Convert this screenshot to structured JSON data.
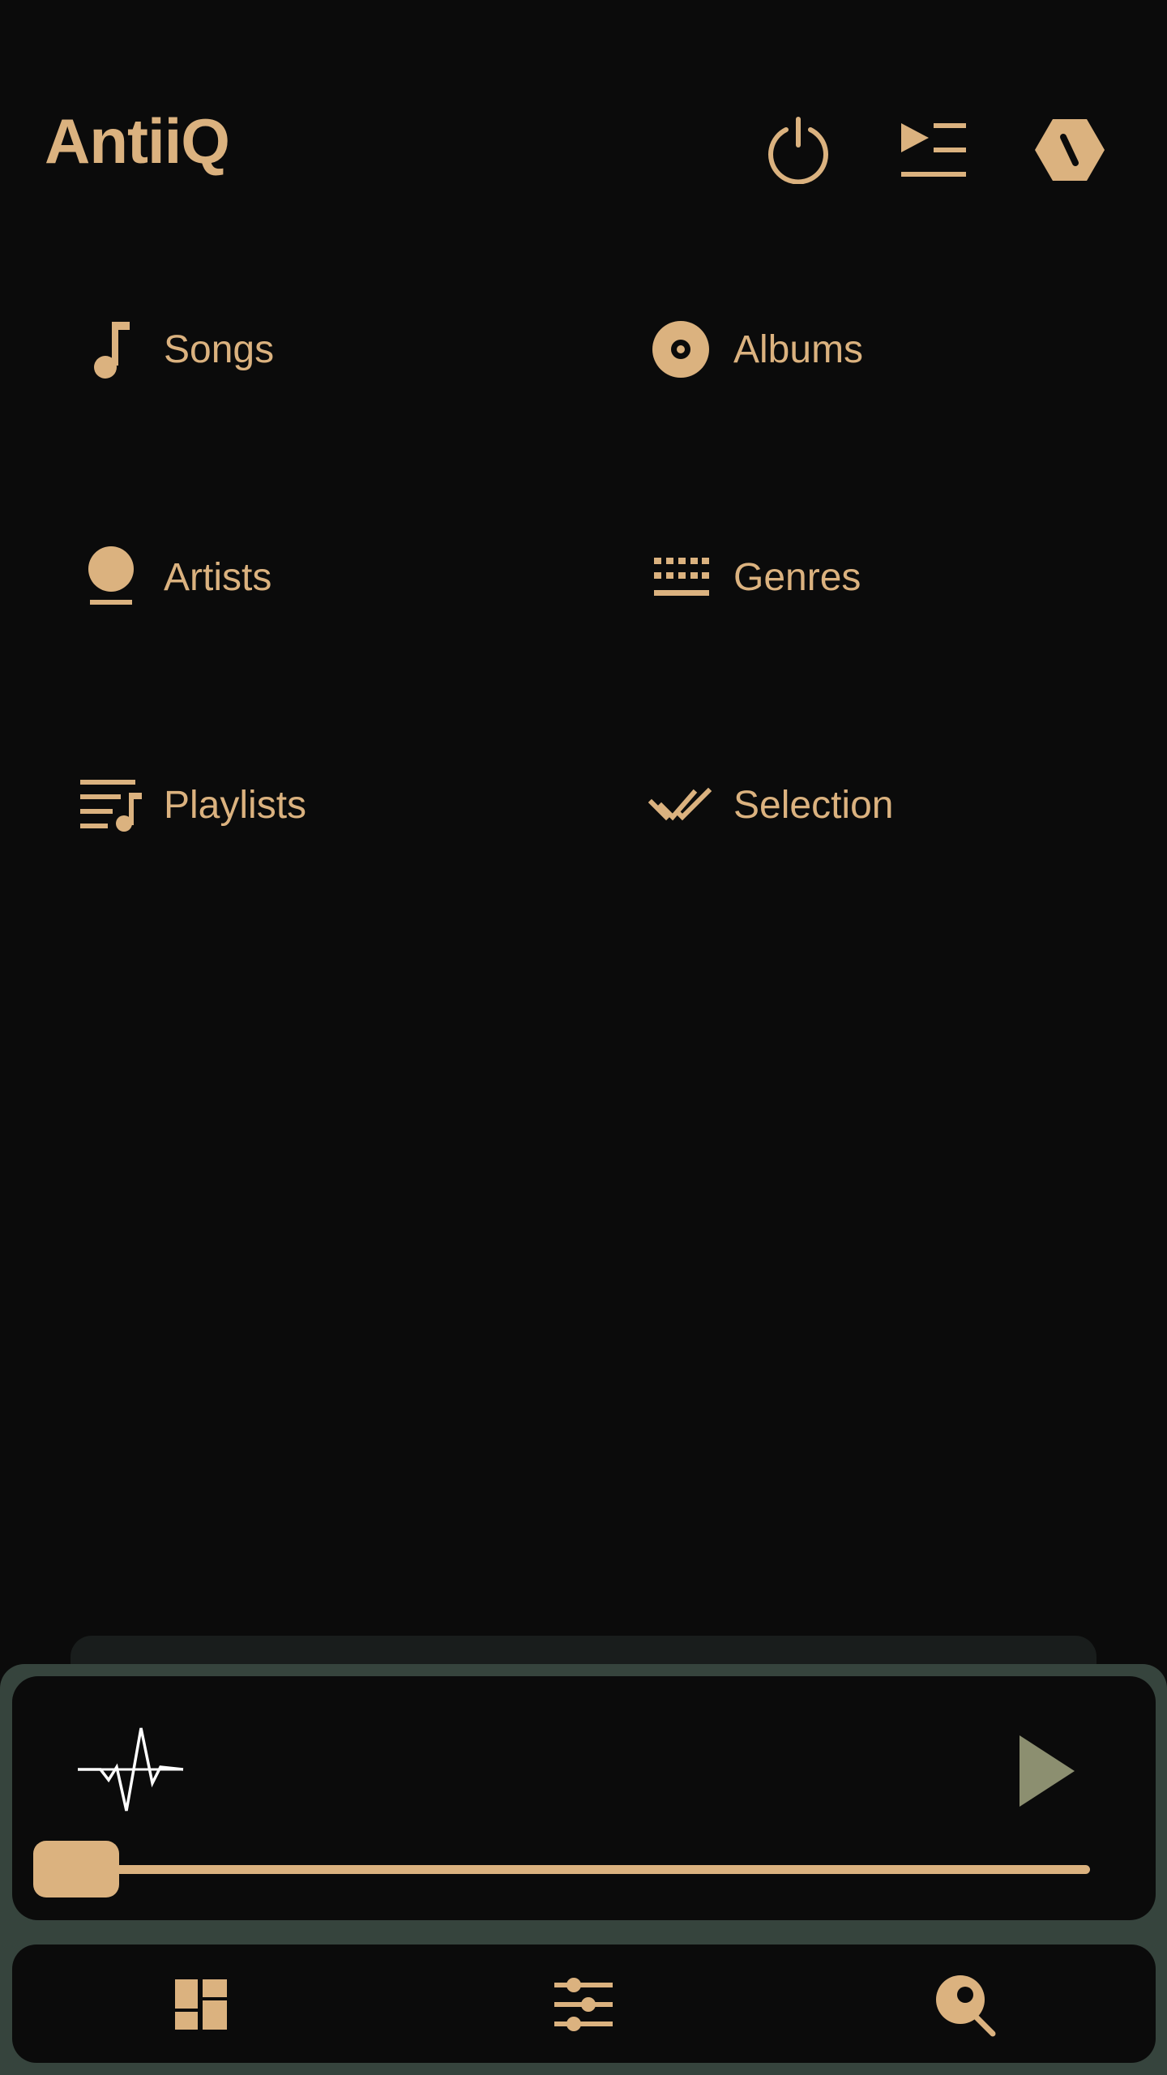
{
  "app": {
    "title": "AntiiQ"
  },
  "header": {
    "buttons": [
      {
        "name": "power",
        "icon": "power-icon"
      },
      {
        "name": "queue",
        "icon": "queue-icon"
      },
      {
        "name": "settings",
        "icon": "hexagon-settings-icon"
      }
    ]
  },
  "categories": [
    {
      "label": "Songs",
      "icon": "music-note-icon"
    },
    {
      "label": "Albums",
      "icon": "album-disc-icon"
    },
    {
      "label": "Artists",
      "icon": "artist-icon"
    },
    {
      "label": "Genres",
      "icon": "genres-grid-icon"
    },
    {
      "label": "Playlists",
      "icon": "playlist-icon"
    },
    {
      "label": "Selection",
      "icon": "double-check-icon"
    }
  ],
  "player": {
    "visualizer_icon": "waveform-icon",
    "play_icon": "play-icon",
    "progress": 0
  },
  "navbar": {
    "items": [
      {
        "name": "dashboard",
        "icon": "dashboard-icon"
      },
      {
        "name": "equalizer",
        "icon": "equalizer-icon"
      },
      {
        "name": "search",
        "icon": "search-icon"
      }
    ]
  },
  "colors": {
    "background": "#0b0b0b",
    "accent": "#dbb27f",
    "frame": "#36443d",
    "play": "#8c8f70"
  }
}
